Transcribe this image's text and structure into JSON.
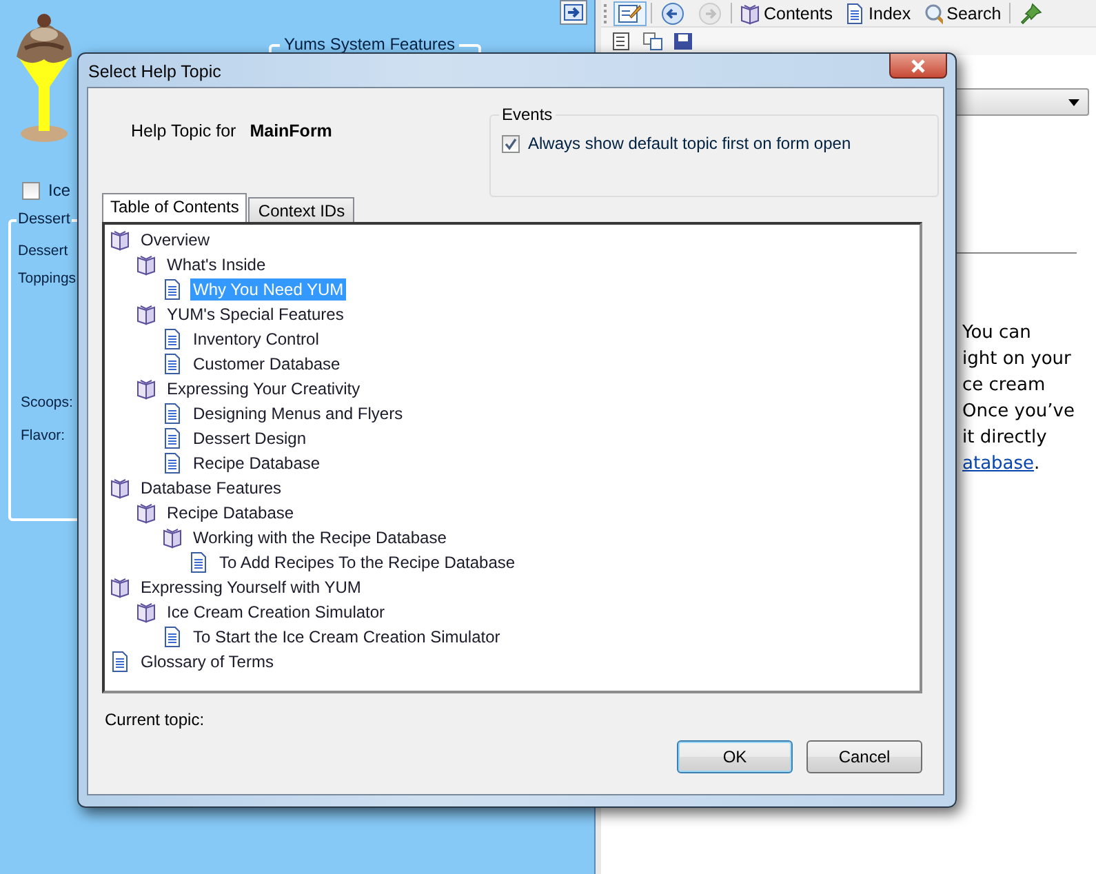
{
  "main_window": {
    "left_panel": {
      "group_title": "Yums System Features",
      "checkbox": {
        "label": "Ice",
        "checked": false
      },
      "dessert_group": {
        "title": "Dessert",
        "labels": [
          "Dessert",
          "Toppings",
          "Scoops:",
          "Flavor:"
        ]
      }
    },
    "help_pane": {
      "toolbar": [
        {
          "kind": "icon",
          "disabled": false
        },
        {
          "kind": "icon",
          "disabled": false
        },
        {
          "kind": "icon",
          "disabled": true
        },
        {
          "kind": "text",
          "label": "Contents",
          "disabled": false
        },
        {
          "kind": "text",
          "label": "Index",
          "disabled": false
        },
        {
          "kind": "text",
          "label": "Search",
          "disabled": false
        },
        {
          "kind": "icon",
          "disabled": false
        }
      ],
      "text_lines": [
        "You can",
        "ight on your",
        "ce cream",
        "Once you’ve",
        "it directly"
      ],
      "link": "atabase",
      "link_tail": "."
    }
  },
  "dialog": {
    "title": "Select Help Topic",
    "help_topic_label": "Help Topic for",
    "form_name": "MainForm",
    "events": {
      "title": "Events",
      "checkbox": {
        "label": "Always show default topic first on form open",
        "checked": true
      }
    },
    "tabs": [
      {
        "label": "Table of Contents",
        "selected": true
      },
      {
        "label": "Context IDs",
        "selected": false
      }
    ],
    "tree": [
      {
        "label": "Overview",
        "kind": "book",
        "selected": false,
        "children": [
          {
            "label": "What's Inside",
            "kind": "book",
            "selected": false,
            "children": [
              {
                "label": "Why You Need YUM",
                "kind": "page",
                "selected": true
              }
            ]
          },
          {
            "label": "YUM's Special Features",
            "kind": "book",
            "selected": false,
            "children": [
              {
                "label": "Inventory Control",
                "kind": "page",
                "selected": false
              },
              {
                "label": "Customer Database",
                "kind": "page",
                "selected": false
              }
            ]
          },
          {
            "label": "Expressing Your Creativity",
            "kind": "book",
            "selected": false,
            "children": [
              {
                "label": "Designing Menus and Flyers",
                "kind": "page",
                "selected": false
              },
              {
                "label": "Dessert Design",
                "kind": "page",
                "selected": false
              },
              {
                "label": "Recipe Database",
                "kind": "page",
                "selected": false
              }
            ]
          }
        ]
      },
      {
        "label": "Database Features",
        "kind": "book",
        "selected": false,
        "children": [
          {
            "label": "Recipe Database",
            "kind": "book",
            "selected": false,
            "children": [
              {
                "label": "Working with the Recipe Database",
                "kind": "book",
                "selected": false,
                "children": [
                  {
                    "label": "To Add Recipes To the Recipe Database",
                    "kind": "page",
                    "selected": false
                  }
                ]
              }
            ]
          }
        ]
      },
      {
        "label": "Expressing Yourself with YUM",
        "kind": "book",
        "selected": false,
        "children": [
          {
            "label": "Ice Cream Creation Simulator",
            "kind": "book",
            "selected": false,
            "children": [
              {
                "label": "To Start the Ice Cream Creation Simulator",
                "kind": "page",
                "selected": false
              }
            ]
          }
        ]
      },
      {
        "label": "Glossary of Terms",
        "kind": "page",
        "selected": false
      }
    ],
    "current_topic_label": "Current topic:",
    "buttons": [
      {
        "label": "OK",
        "default": true
      },
      {
        "label": "Cancel",
        "default": false
      }
    ]
  }
}
